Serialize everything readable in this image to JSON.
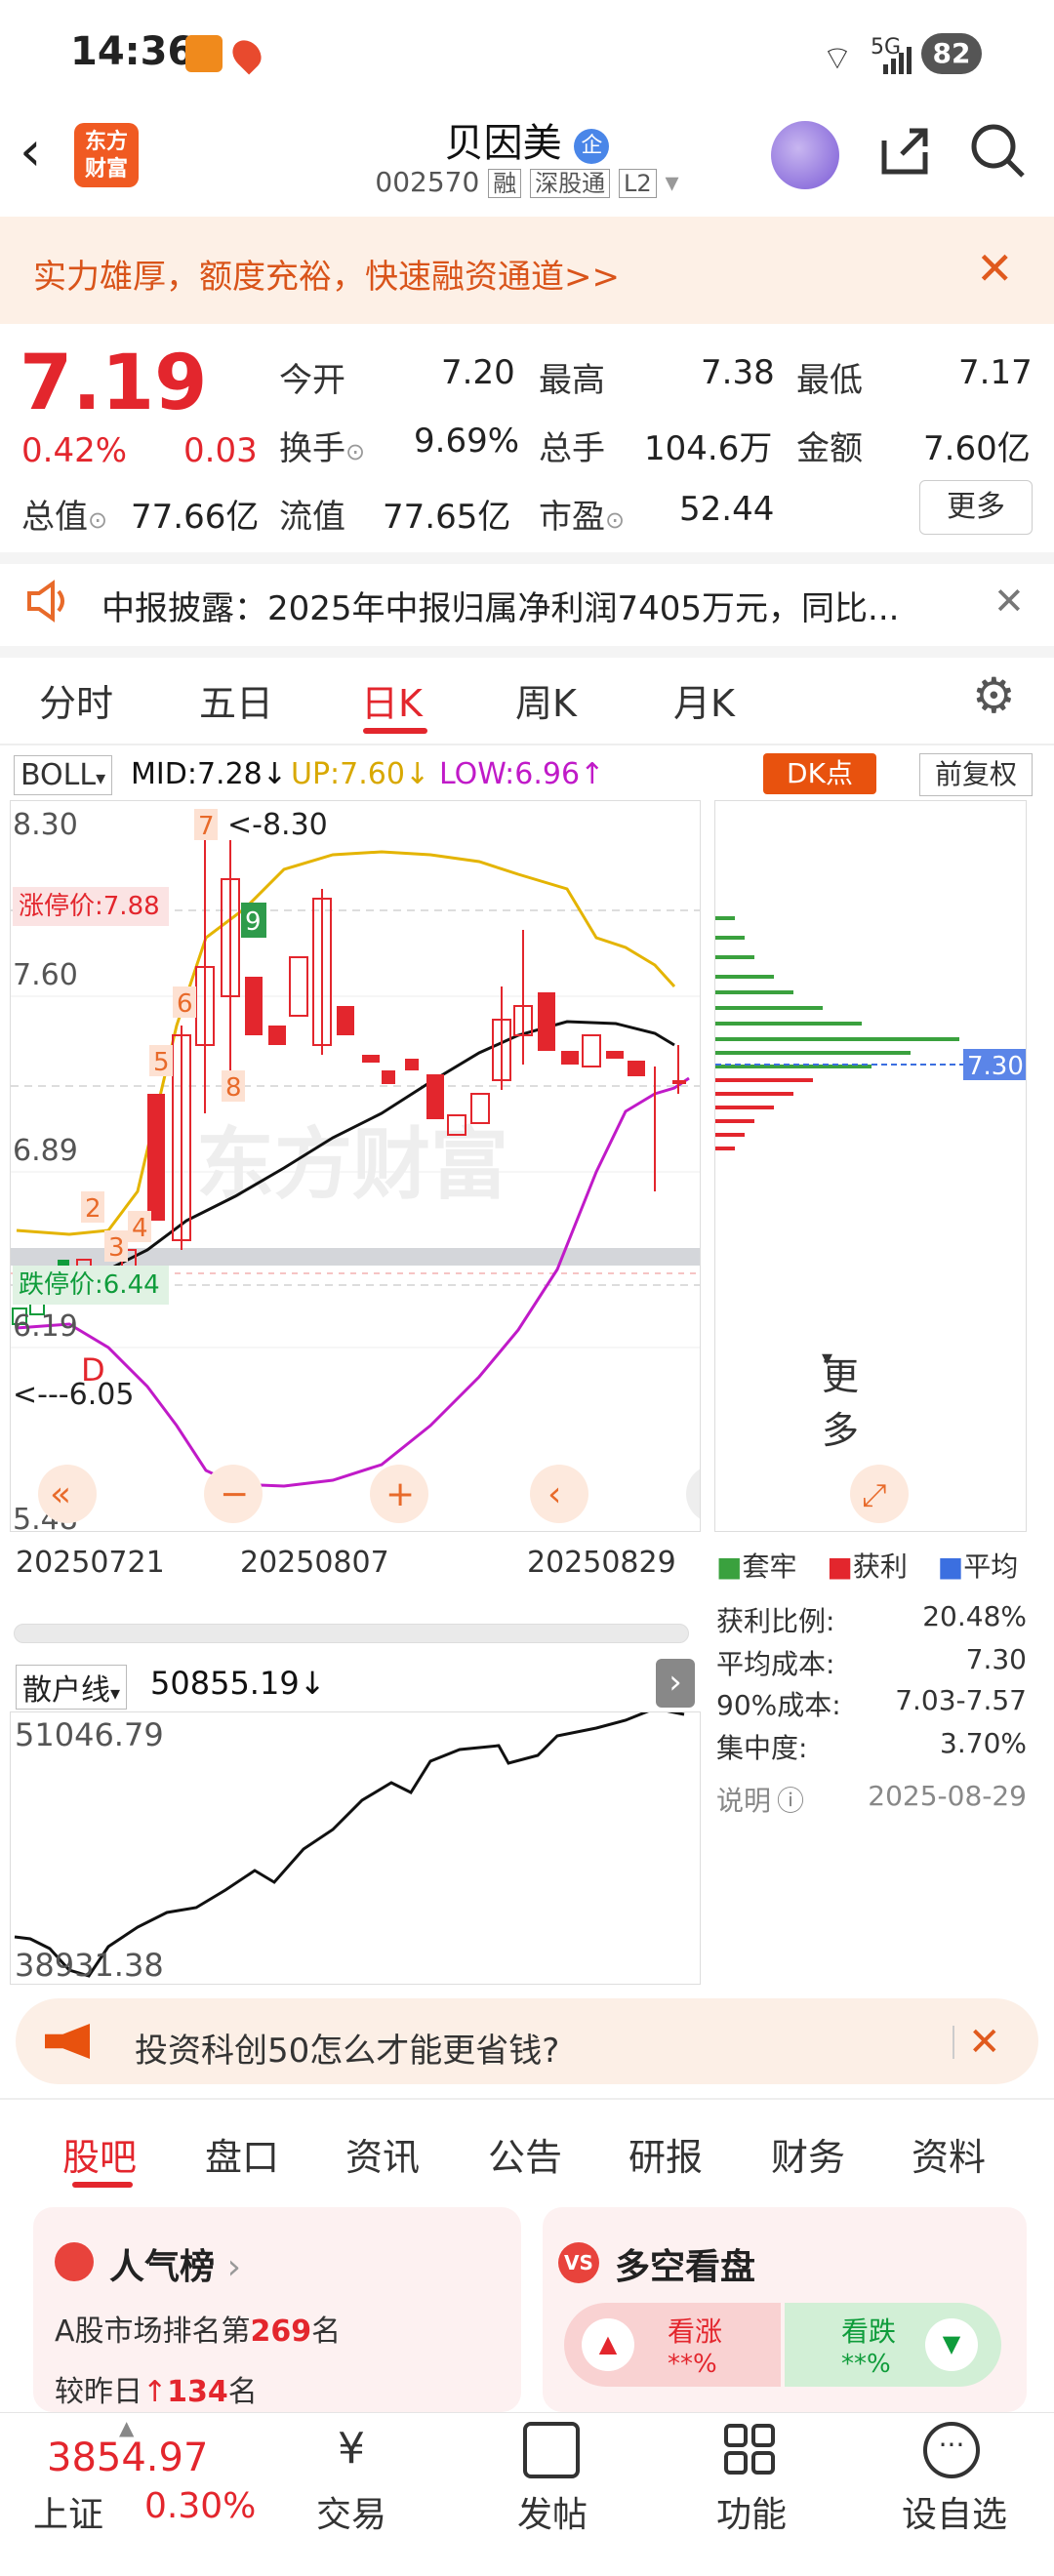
{
  "status": {
    "time": "14:36",
    "battery": "82",
    "net": "5G"
  },
  "header": {
    "title": "贝因美",
    "badge": "企",
    "code": "002570",
    "tags": [
      "融",
      "深股通",
      "L2"
    ],
    "logo": "东方\n财富"
  },
  "banner": {
    "text": "实力雄厚，额度充裕，快速融资通道>>"
  },
  "quote": {
    "price": "7.19",
    "pct": "0.42%",
    "chg": "0.03",
    "fields": [
      {
        "label": "今开",
        "value": "7.20"
      },
      {
        "label": "最高",
        "value": "7.38"
      },
      {
        "label": "最低",
        "value": "7.17"
      },
      {
        "label": "换手",
        "value": "9.69%"
      },
      {
        "label": "总手",
        "value": "104.6万"
      },
      {
        "label": "金额",
        "value": "7.60亿"
      },
      {
        "label": "总值",
        "value": "77.66亿"
      },
      {
        "label": "流值",
        "value": "77.65亿"
      },
      {
        "label": "市盈",
        "value": "52.44"
      }
    ],
    "more": "更多"
  },
  "notice": {
    "text": "中报披露：2025年中报归属净利润7405万元，同比..."
  },
  "kline_tabs": [
    "分时",
    "五日",
    "日K",
    "周K",
    "月K",
    "更多"
  ],
  "boll": {
    "name": "BOLL",
    "mid": "MID:7.28↓",
    "up": "UP:7.60↓",
    "low": "LOW:6.96↑",
    "dk": "DK点",
    "adj": "前复权"
  },
  "chart_data": {
    "type": "candlestick",
    "y_ticks": [
      "8.30",
      "7.60",
      "6.89",
      "6.19",
      "5.48"
    ],
    "x_ticks": [
      "20250721",
      "20250807",
      "20250829"
    ],
    "limit_up": "涨停价:7.88",
    "limit_down": "跌停价:6.44",
    "max_label": "<-8.30",
    "min_label": "<---6.05",
    "watermark": "东方财富",
    "markers": [
      "2",
      "3",
      "4",
      "5",
      "6",
      "7",
      "8",
      "9",
      "D"
    ]
  },
  "chip": {
    "avg_tag": "7.30",
    "legend": [
      "套牢",
      "获利",
      "平均"
    ],
    "rows": [
      {
        "label": "获利比例:",
        "value": "20.48%"
      },
      {
        "label": "平均成本:",
        "value": "7.30"
      },
      {
        "label": "90%成本:",
        "value": "7.03-7.57"
      },
      {
        "label": "集中度:",
        "value": "3.70%"
      }
    ],
    "note": "说明",
    "date": "2025-08-29"
  },
  "retail": {
    "name": "散户线",
    "value": "50855.19↓",
    "high": "51046.79",
    "low": "38931.38"
  },
  "ad": {
    "text": "投资科创50怎么才能更省钱?"
  },
  "bottom_tabs": [
    "股吧",
    "盘口",
    "资讯",
    "公告",
    "研报",
    "财务",
    "资料"
  ],
  "cards": {
    "hot": {
      "title": "人气榜",
      "line1": "A股市场排名第",
      "rank": "269",
      "line1_end": "名",
      "line2": "较昨日",
      "delta": "134",
      "line2_end": "名"
    },
    "vs": {
      "title": "多空看盘",
      "up": "看涨",
      "up_val": "**%",
      "down": "看跌",
      "down_val": "**%"
    }
  },
  "footer": {
    "index_value": "3854.97",
    "index_name": "上证",
    "index_pct": "0.30%",
    "items": [
      "交易",
      "发帖",
      "功能",
      "设自选"
    ]
  }
}
